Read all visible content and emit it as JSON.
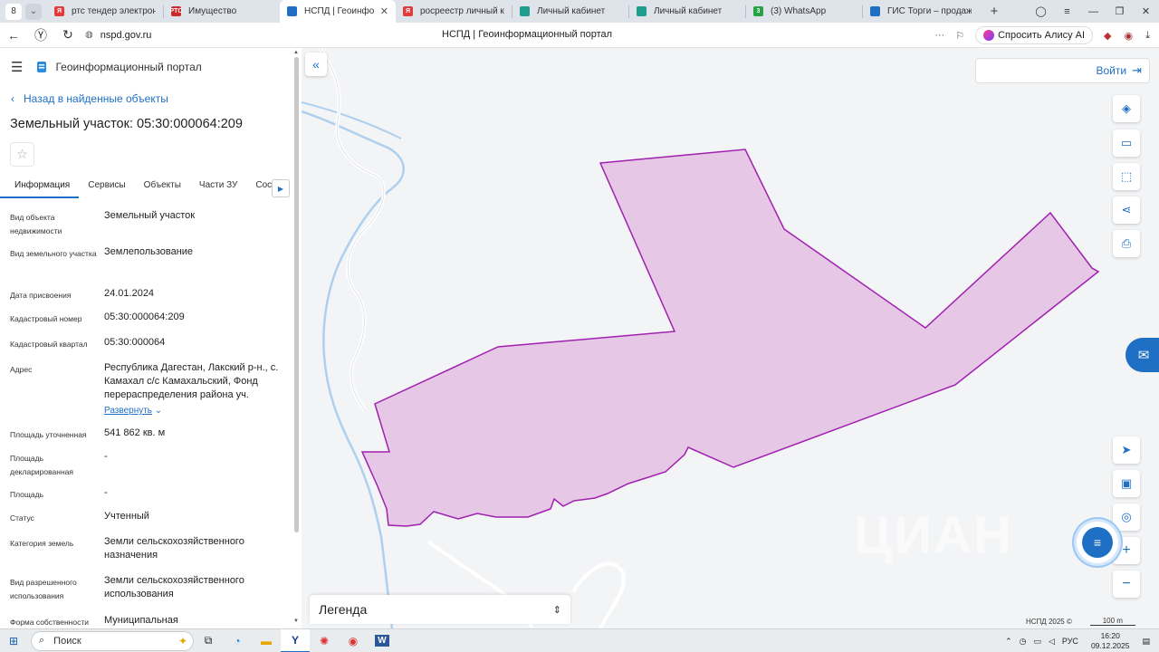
{
  "browser": {
    "tab_counter": "8",
    "tabs": [
      {
        "label": "ртс тендер электронная",
        "favicon_color": "#e23b3b",
        "favicon_text": "Я"
      },
      {
        "label": "Имущество",
        "favicon_color": "#cc2a2a",
        "favicon_text": "РТС"
      },
      {
        "label": "НСПД | Геоинформац",
        "favicon_color": "#1f6fc5",
        "favicon_text": "",
        "active": true
      },
      {
        "label": "росреестр личный каби",
        "favicon_color": "#e23b3b",
        "favicon_text": "Я"
      },
      {
        "label": "Личный кабинет",
        "favicon_color": "#1e9d8f",
        "favicon_text": ""
      },
      {
        "label": "Личный кабинет",
        "favicon_color": "#1e9d8f",
        "favicon_text": ""
      },
      {
        "label": "(3) WhatsApp",
        "favicon_color": "#25a244",
        "favicon_text": "3"
      },
      {
        "label": "ГИС Торги – продажи го",
        "favicon_color": "#1f6fc5",
        "favicon_text": ""
      }
    ],
    "url": "nspd.gov.ru",
    "page_title": "НСПД | Геоинформационный портал",
    "alice_label": "Спросить Алису AI"
  },
  "sidebar": {
    "portal_title": "Геоинформационный портал",
    "back_label": "Назад в найденные объекты",
    "parcel_title": "Земельный участок: 05:30:000064:209",
    "tabs": [
      "Информация",
      "Сервисы",
      "Объекты",
      "Части ЗУ",
      "Соста"
    ],
    "properties": [
      {
        "label": "Вид объекта недвижимости",
        "value": "Земельный участок"
      },
      {
        "label": "Вид земельного участка",
        "value": "Землепользование"
      },
      {
        "label": "Дата присвоения",
        "value": "24.01.2024"
      },
      {
        "label": "Кадастровый номер",
        "value": "05:30:000064:209"
      },
      {
        "label": "Кадастровый квартал",
        "value": "05:30:000064"
      },
      {
        "label": "Адрес",
        "value": "Республика Дагестан, Лакский р-н., с. Камахал с/с Камахальский, Фонд перераспределения района уч.",
        "link": "Развернуть"
      },
      {
        "label": "Площадь уточненная",
        "value": "541 862 кв. м"
      },
      {
        "label": "Площадь декларированная",
        "value": "-"
      },
      {
        "label": "Площадь",
        "value": "-"
      },
      {
        "label": "Статус",
        "value": "Учтенный"
      },
      {
        "label": "Категория земель",
        "value": "Земли сельскохозяйственного назначения"
      },
      {
        "label": "Вид разрешенного использования",
        "value": "Земли сельскохозяйственного использования"
      },
      {
        "label": "Форма собственности",
        "value": "Муниципальная"
      }
    ]
  },
  "map": {
    "login_label": "Войти",
    "legend_label": "Легенда",
    "footer_copyright": "НСПД 2025 ©",
    "scale_label": "100 m",
    "watermark": "ЦИАН",
    "parcel_fill": "#e6c8e6",
    "parcel_stroke": "#a020b0"
  },
  "taskbar": {
    "search_label": "Поиск",
    "lang": "РУС",
    "time": "16:20",
    "date": "09.12.2025"
  }
}
